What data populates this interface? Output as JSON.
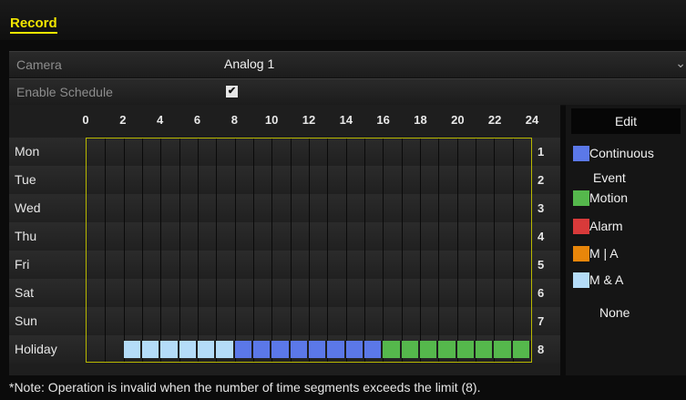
{
  "page": {
    "title": "Record"
  },
  "form": {
    "camera_label": "Camera",
    "camera_value": "Analog 1",
    "schedule_label": "Enable Schedule",
    "schedule_checked": "✔"
  },
  "schedule": {
    "hours": [
      "0",
      "2",
      "4",
      "6",
      "8",
      "10",
      "12",
      "14",
      "16",
      "18",
      "20",
      "22",
      "24"
    ],
    "days": [
      {
        "label": "Mon",
        "num": "1"
      },
      {
        "label": "Tue",
        "num": "2"
      },
      {
        "label": "Wed",
        "num": "3"
      },
      {
        "label": "Thu",
        "num": "4"
      },
      {
        "label": "Fri",
        "num": "5"
      },
      {
        "label": "Sat",
        "num": "6"
      },
      {
        "label": "Sun",
        "num": "7"
      },
      {
        "label": "Holiday",
        "num": "8"
      }
    ],
    "holiday_segments": [
      {
        "start": 2,
        "end": 8,
        "type": "M & A"
      },
      {
        "start": 8,
        "end": 16,
        "type": "Continuous"
      },
      {
        "start": 16,
        "end": 24,
        "type": "Motion"
      }
    ]
  },
  "legend": {
    "edit": "Edit",
    "continuous": "Continuous",
    "event": "Event",
    "motion": "Motion",
    "alarm": "Alarm",
    "m_or_a": "M | A",
    "m_and_a": "M & A",
    "none": "None",
    "colors": {
      "Continuous": "#5b78e8",
      "Motion": "#55b84c",
      "Alarm": "#d83a3a",
      "M | A": "#e8860a",
      "M & A": "#b4dcf8"
    }
  },
  "footer": {
    "note": "*Note: Operation is invalid when the number of time segments exceeds the limit (8)."
  }
}
